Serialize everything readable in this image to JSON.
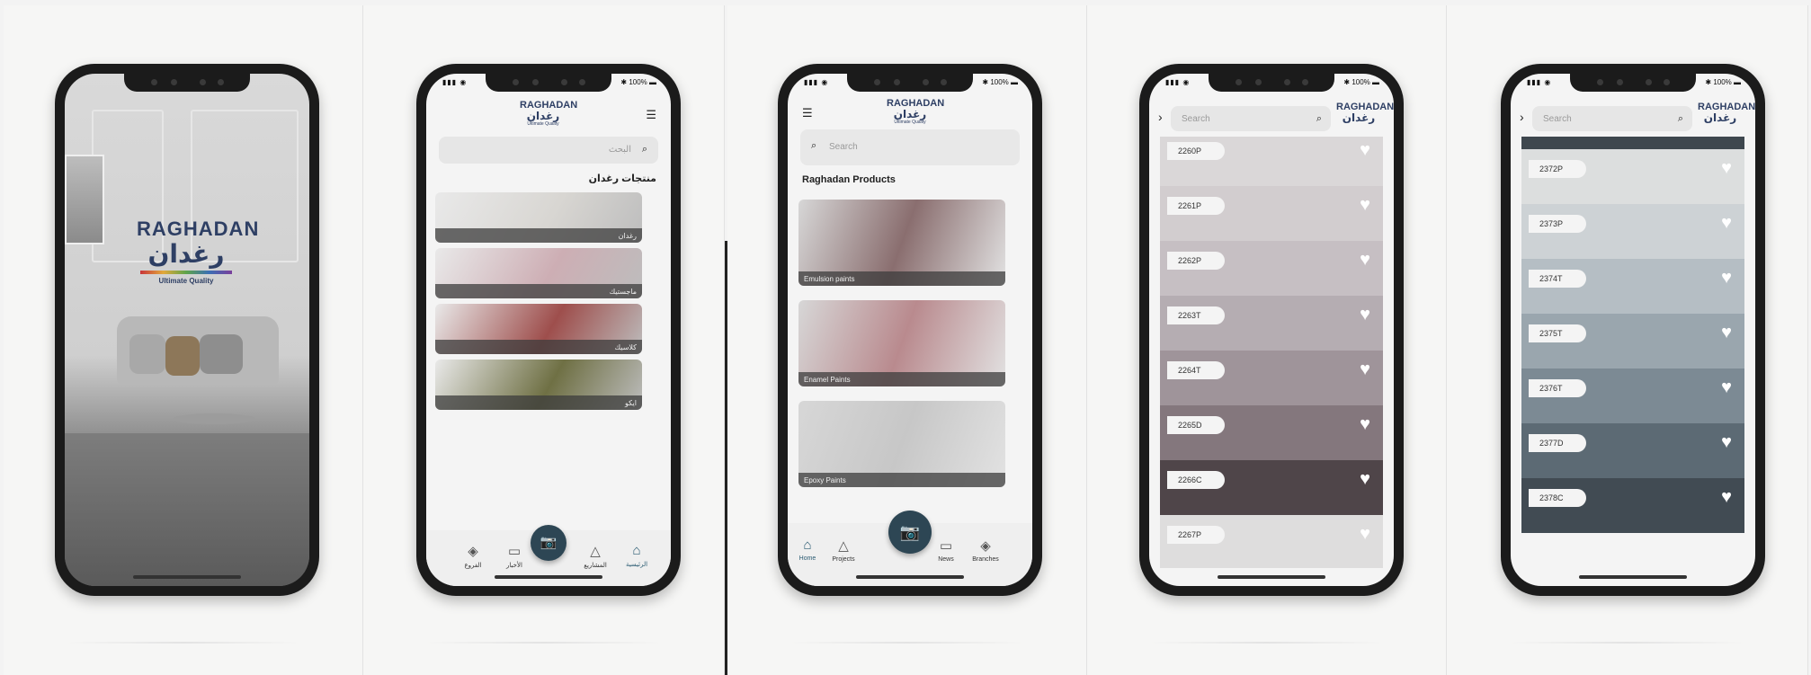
{
  "status": {
    "signal": "▮▮▮ ◉",
    "battery": "✱ 100% ▬"
  },
  "splash": {
    "logo_en": "RAGHADAN",
    "logo_ar": "رغدان",
    "tagline": "Ultimate Quality"
  },
  "screen_ar": {
    "logo_en": "RAGHADAN",
    "logo_ar": "رغدان",
    "logo_q": "Ultimate Quality",
    "search_placeholder": "البحث",
    "section_title": "منتجات رغدان",
    "products": [
      {
        "label": "رغدان",
        "color": "#d8d6d2"
      },
      {
        "label": "ماجستيك",
        "color": "#cdaeb4"
      },
      {
        "label": "كلاسيك",
        "color": "#9e4e4c"
      },
      {
        "label": "ايكو",
        "color": "#6f7044"
      }
    ],
    "nav": [
      {
        "label": "الرئيسية",
        "icon": "home-icon"
      },
      {
        "label": "المشاريع",
        "icon": "projects-icon"
      },
      {
        "label": "الأخبار",
        "icon": "news-icon"
      },
      {
        "label": "الفروع",
        "icon": "branches-icon"
      }
    ]
  },
  "screen_en": {
    "logo_en": "RAGHADAN",
    "logo_ar": "رغدان",
    "logo_q": "Ultimate Quality",
    "search_placeholder": "Search",
    "section_title": "Raghadan Products",
    "products": [
      {
        "label": "Emulsion paints",
        "color": "#8a6e6f"
      },
      {
        "label": "Enamel Paints",
        "color": "#b98a8e"
      },
      {
        "label": "Epoxy Paints",
        "color": "#c7c7c7"
      }
    ],
    "nav": [
      {
        "label": "Home",
        "icon": "home-icon"
      },
      {
        "label": "Projects",
        "icon": "projects-icon"
      },
      {
        "label": "News",
        "icon": "news-icon"
      },
      {
        "label": "Branches",
        "icon": "branches-icon"
      }
    ]
  },
  "palette_a": {
    "search_placeholder": "Search",
    "logo_en": "RAGHADAN",
    "logo_ar": "رغدان",
    "swatches": [
      {
        "code": "2260P",
        "color": "#dad7d8"
      },
      {
        "code": "2261P",
        "color": "#d2cdcf"
      },
      {
        "code": "2262P",
        "color": "#c6bfc3"
      },
      {
        "code": "2263T",
        "color": "#b5adb2"
      },
      {
        "code": "2264T",
        "color": "#9f949a"
      },
      {
        "code": "2265D",
        "color": "#84777d"
      },
      {
        "code": "2266C",
        "color": "#4f4549"
      },
      {
        "code": "2267P",
        "color": "#dedddd"
      }
    ]
  },
  "palette_b": {
    "search_placeholder": "Search",
    "logo_en": "RAGHADAN",
    "logo_ar": "رغدان",
    "swatches": [
      {
        "code": "2372P",
        "color": "#dcdede"
      },
      {
        "code": "2373P",
        "color": "#cdd2d5"
      },
      {
        "code": "2374T",
        "color": "#b5bec4"
      },
      {
        "code": "2375T",
        "color": "#9aa6ae"
      },
      {
        "code": "2376T",
        "color": "#7c8a94"
      },
      {
        "code": "2377D",
        "color": "#5c6a74"
      },
      {
        "code": "2378C",
        "color": "#414b53"
      }
    ]
  }
}
